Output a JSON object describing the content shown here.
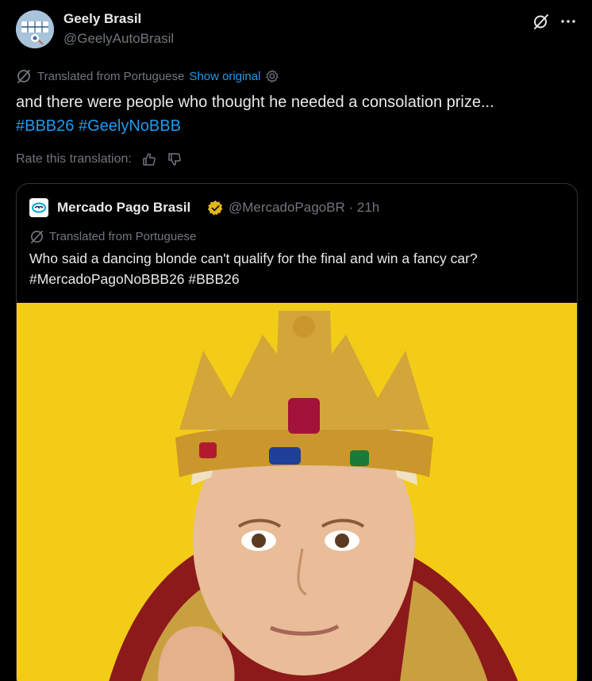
{
  "post": {
    "author_name": "Geely Brasil",
    "author_handle": "@GeelyAutoBrasil",
    "translation_note": "Translated from Portuguese",
    "show_original_label": "Show original",
    "text_line1": "and there were people who thought he needed a consolation prize...",
    "hashtags": [
      "#BBB26",
      "#GeelyNoBBB"
    ],
    "rate_label": "Rate this translation:"
  },
  "quote": {
    "author_name": "Mercado Pago Brasil",
    "author_handle": "@MercadoPagoBR",
    "separator": "·",
    "time": "21h",
    "translation_note": "Translated from Portuguese",
    "text_line1": "Who said a dancing blonde can't qualify for the final and win a fancy car?",
    "text_line2": "#MercadoPagoNoBBB26 #BBB26"
  },
  "icons": {
    "grok": "grok-icon",
    "more": "more-icon",
    "translate": "translate-icon",
    "settings": "gear-icon",
    "like": "thumbs-up-icon",
    "dislike": "thumbs-down-icon",
    "verified": "verified-badge-icon"
  },
  "colors": {
    "background": "#000000",
    "text": "#e7e9ea",
    "secondary": "#71767b",
    "link": "#1d9bf0",
    "verified_gold": "#e2b719",
    "image_background": "#f3cc17"
  }
}
